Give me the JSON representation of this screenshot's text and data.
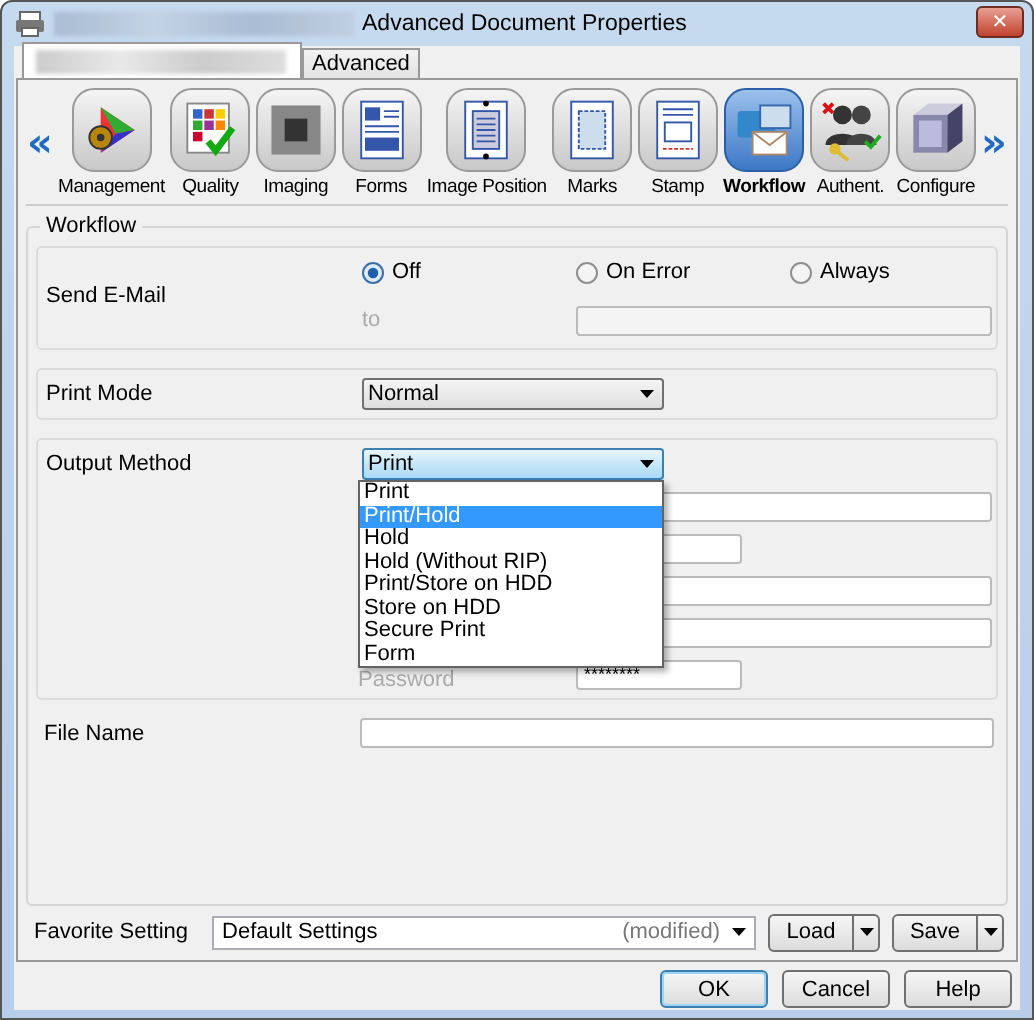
{
  "window": {
    "title": "Advanced Document Properties",
    "close": "✕",
    "redacted": true
  },
  "tabs": [
    {
      "selected": true,
      "redacted": true
    },
    {
      "label": "Advanced",
      "selected": false
    }
  ],
  "toolbar": {
    "prev": "«",
    "next": "»",
    "items": [
      {
        "label": "Management",
        "selected": false
      },
      {
        "label": "Quality",
        "selected": false
      },
      {
        "label": "Imaging",
        "selected": false
      },
      {
        "label": "Forms",
        "selected": false
      },
      {
        "label": "Image Position",
        "selected": false
      },
      {
        "label": "Marks",
        "selected": false
      },
      {
        "label": "Stamp",
        "selected": false
      },
      {
        "label": "Workflow",
        "selected": true
      },
      {
        "label": "Authent.",
        "selected": false
      },
      {
        "label": "Configure",
        "selected": false
      }
    ]
  },
  "workflow": {
    "title": "Workflow",
    "send_email": {
      "label": "Send E-Mail",
      "options": [
        {
          "label": "Off",
          "selected": true
        },
        {
          "label": "On Error",
          "selected": false
        },
        {
          "label": "Always",
          "selected": false
        }
      ],
      "to_label": "to",
      "disabled": true
    },
    "print_mode": {
      "label": "Print Mode",
      "value": "Normal"
    },
    "output_method": {
      "label": "Output Method",
      "value": "Print",
      "expanded": true,
      "options": [
        {
          "label": "Print",
          "highlighted": false
        },
        {
          "label": "Print/Hold",
          "highlighted": true
        },
        {
          "label": "Hold",
          "highlighted": false
        },
        {
          "label": "Hold (Without RIP)",
          "highlighted": false
        },
        {
          "label": "Print/Store on HDD",
          "highlighted": false
        },
        {
          "label": "Store on HDD",
          "highlighted": false
        },
        {
          "label": "Secure Print",
          "highlighted": false
        },
        {
          "label": "Form",
          "highlighted": false
        }
      ],
      "password_label": "Password",
      "password_value": "********"
    },
    "file_name": {
      "label": "File Name"
    }
  },
  "favorite": {
    "label": "Favorite Setting",
    "value": "Default Settings",
    "status": "(modified)",
    "buttons": [
      "Load",
      "Save"
    ]
  },
  "buttons": [
    {
      "label": "OK",
      "default": true
    },
    {
      "label": "Cancel",
      "default": false
    },
    {
      "label": "Help",
      "default": false
    }
  ]
}
